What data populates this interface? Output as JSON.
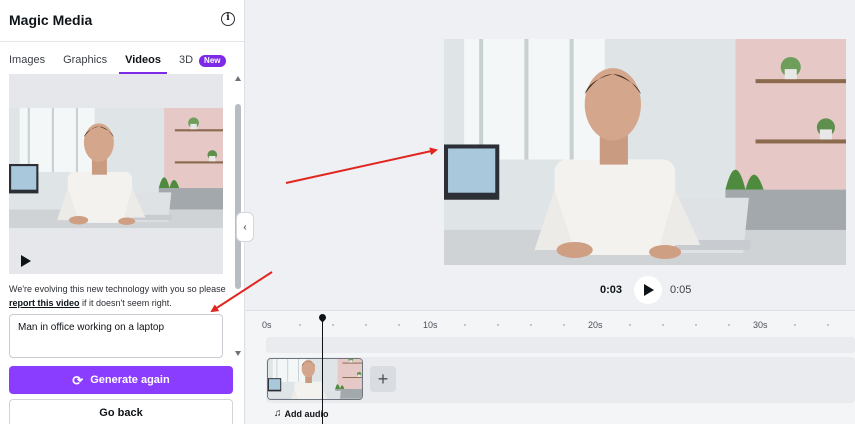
{
  "sidebar": {
    "title": "Magic Media",
    "tabs": [
      {
        "label": "Images",
        "active": false
      },
      {
        "label": "Graphics",
        "active": false
      },
      {
        "label": "Videos",
        "active": true
      },
      {
        "label": "3D",
        "active": false,
        "badge": "New"
      }
    ],
    "disclaimer_prefix": "We're evolving this new technology with you so please",
    "disclaimer_link": "report this video",
    "disclaimer_suffix": "if it doesn't seem right.",
    "prompt_value": "Man in office working on a laptop",
    "generate_label": "Generate again",
    "back_label": "Go back"
  },
  "player": {
    "current_time": "0:03",
    "total_time": "0:05"
  },
  "timeline": {
    "ticks": [
      "0s",
      "10s",
      "20s",
      "30s"
    ],
    "add_audio_label": "Add audio"
  },
  "icons": {
    "info": "info-icon",
    "collapse": "chevron-left-icon",
    "play": "play-icon",
    "refresh": "refresh-icon",
    "add": "plus-icon",
    "audio": "music-note-icon"
  },
  "colors": {
    "accent": "#8b3dff",
    "tab_underline": "#7d2ae8",
    "annotation_arrow": "#e0261f"
  }
}
